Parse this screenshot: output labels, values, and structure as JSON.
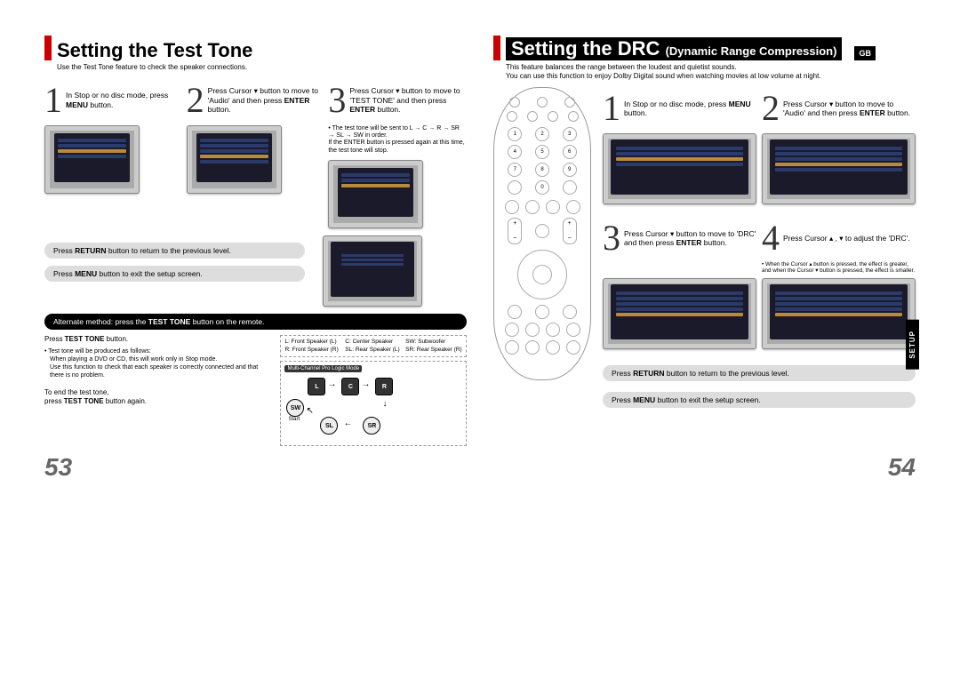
{
  "left": {
    "title": "Setting the Test Tone",
    "subtitle": "Use the Test Tone feature to check the speaker connections.",
    "steps": [
      {
        "num": "1",
        "text_pre": "In Stop or no disc mode, press ",
        "bold": "MENU",
        "text_post": " button."
      },
      {
        "num": "2",
        "text_pre": "Press Cursor ▾ button to move to 'Audio' and then press ",
        "bold": "ENTER",
        "text_post": " button."
      },
      {
        "num": "3",
        "text_pre": "Press Cursor ▾ button to move to 'TEST TONE' and then press ",
        "bold": "ENTER",
        "text_post": " button."
      }
    ],
    "tone_note_l1": "The test tone will be sent to L → C → R → SR → SL → SW in order.",
    "tone_note_l2": "If the ENTER button is pressed again at this time, the test tone will stop.",
    "return_line_pre": "Press ",
    "return_bold": "RETURN",
    "return_line_post": " button to return to the previous level.",
    "menu_line_pre": "Press ",
    "menu_bold": "MENU",
    "menu_line_post": " button to exit the setup screen.",
    "alt_method_pre": "Alternate method: press the ",
    "alt_method_bold": "TEST TONE",
    "alt_method_post": " button on the remote.",
    "press_tt_pre": "Press ",
    "press_tt_bold": "TEST TONE",
    "press_tt_post": " button.",
    "produced_note_l1": "Test tone will be produced as follows:",
    "produced_note_l2": "When playing a DVD or CD, this will work only in Stop mode.",
    "produced_note_l3": "Use this function to check that each speaker is correctly connected and that there is no problem.",
    "end_note_l1": "To end the test tone,",
    "end_note_pre": "press ",
    "end_note_bold": "TEST TONE",
    "end_note_post": " button again.",
    "legend": {
      "l": "L: Front Speaker (L)",
      "c": "C: Center Speaker",
      "sw": "SW: Subwoofer",
      "r": "R: Front Speaker (R)",
      "sl": "SL: Rear Speaker (L)",
      "sr": "SR: Rear Speaker (R)"
    },
    "diag_mode": "Multi-Channel Pro Logic Mode",
    "diag_start": "Start",
    "sp": {
      "l": "L",
      "c": "C",
      "r": "R",
      "sw": "SW",
      "sl": "SL",
      "sr": "SR"
    },
    "page": "53"
  },
  "right": {
    "title_main": "Setting the DRC ",
    "title_sub": "(Dynamic Range Compression)",
    "gb": "GB",
    "sub_l1": "This feature balances the range between the loudest and quietist sounds.",
    "sub_l2": "You can use this function to enjoy Dolby Digital sound when watching movies at low volume at night.",
    "steps": [
      {
        "num": "1",
        "text_pre": "In Stop or no disc mode, press ",
        "bold": "MENU",
        "text_post": " button."
      },
      {
        "num": "2",
        "text_pre": "Press Cursor ▾ button to move to 'Audio' and then press ",
        "bold": "ENTER",
        "text_post": " button."
      },
      {
        "num": "3",
        "text_pre": "Press Cursor ▾ button to move to 'DRC' and then press ",
        "bold": "ENTER",
        "text_post": " button."
      },
      {
        "num": "4",
        "text_pre": "Press Cursor ▴ , ▾ to adjust the 'DRC'.",
        "bold": "",
        "text_post": ""
      }
    ],
    "cursor_note": "When the Cursor ▴ button is pressed, the effect is greater, and when the Cursor ▾ button is pressed, the effect is smaller.",
    "return_line_pre": "Press ",
    "return_bold": "RETURN",
    "return_line_post": " button to return to the previous level.",
    "menu_line_pre": "Press ",
    "menu_bold": "MENU",
    "menu_line_post": " button to exit the setup screen.",
    "setup_tab": "SETUP",
    "page": "54"
  }
}
